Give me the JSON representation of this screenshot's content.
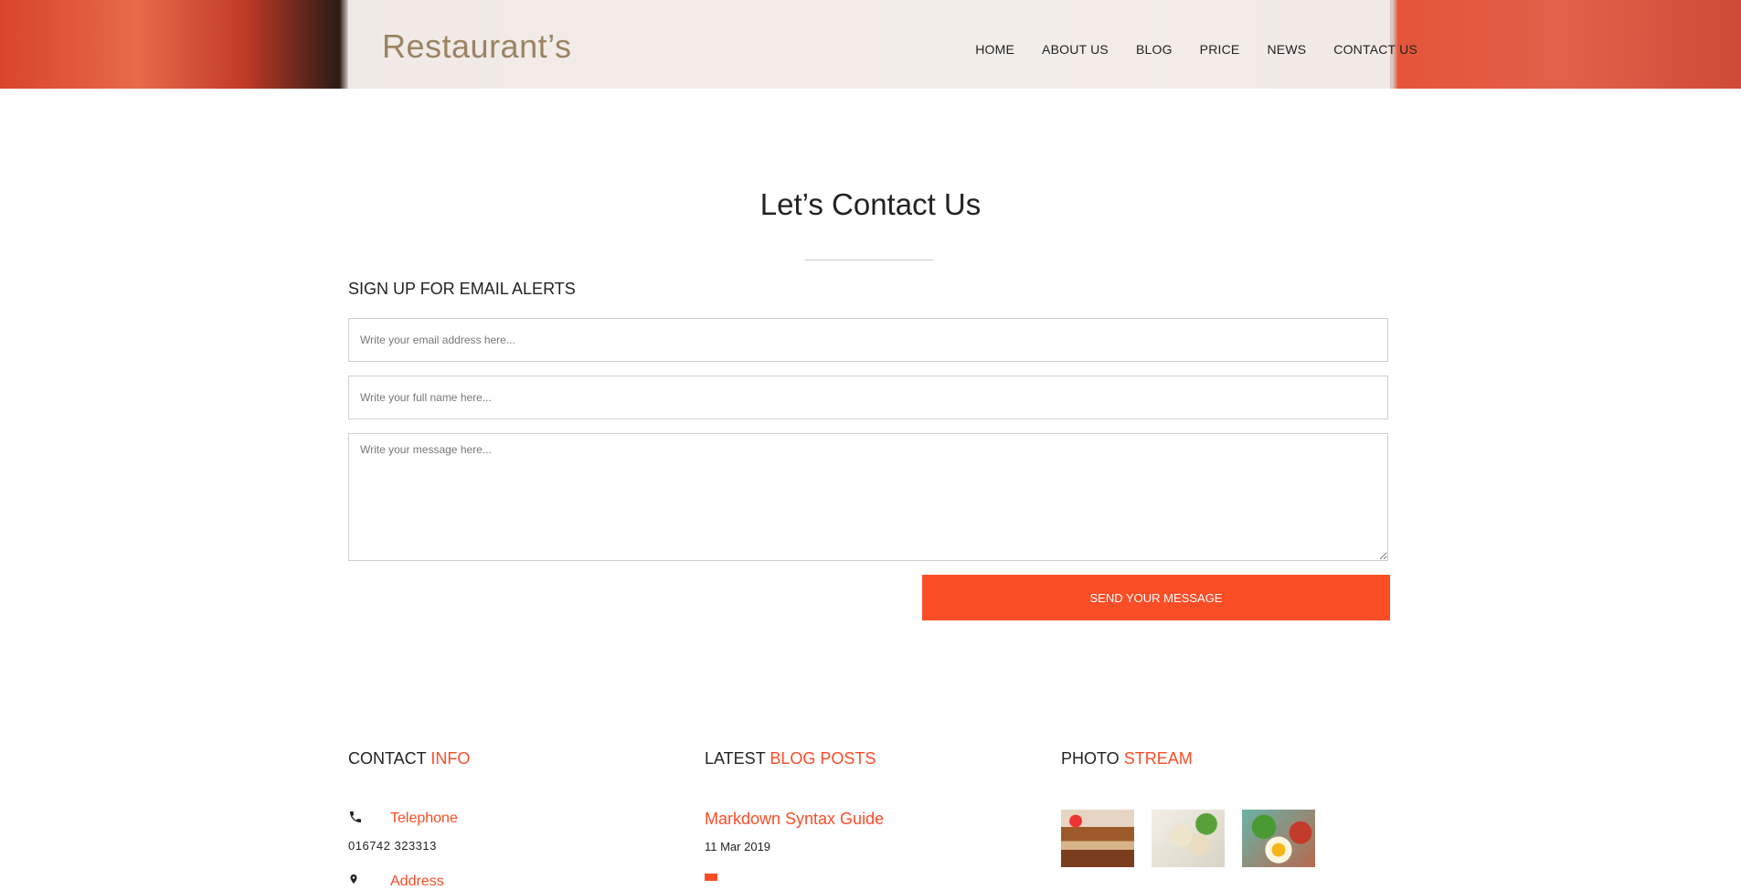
{
  "header": {
    "logo": "Restaurant’s",
    "nav": [
      {
        "label": "HOME"
      },
      {
        "label": "ABOUT US"
      },
      {
        "label": "BLOG"
      },
      {
        "label": "PRICE"
      },
      {
        "label": "NEWS"
      },
      {
        "label": "CONTACT US"
      }
    ]
  },
  "main": {
    "title": "Let’s Contact Us",
    "form_heading": "SIGN UP FOR EMAIL ALERTS",
    "email_placeholder": "Write your email address here...",
    "name_placeholder": "Write your full name here...",
    "message_placeholder": "Write your message here...",
    "send_label": "SEND YOUR MESSAGE"
  },
  "footer": {
    "contact": {
      "heading_main": "CONTACT ",
      "heading_accent": "INFO",
      "telephone_label": "Telephone",
      "telephone_value": "016742 323313",
      "address_label": "Address"
    },
    "blog": {
      "heading_main": "LATEST ",
      "heading_accent": "BLOG POSTS",
      "post_title": "Markdown Syntax Guide",
      "post_date": "11 Mar 2019"
    },
    "photos": {
      "heading_main": "PHOTO ",
      "heading_accent": "STREAM"
    }
  },
  "colors": {
    "accent": "#fb4d26",
    "logo": "#9a8462"
  },
  "icons": [
    "phone-icon",
    "map-pin-icon"
  ]
}
